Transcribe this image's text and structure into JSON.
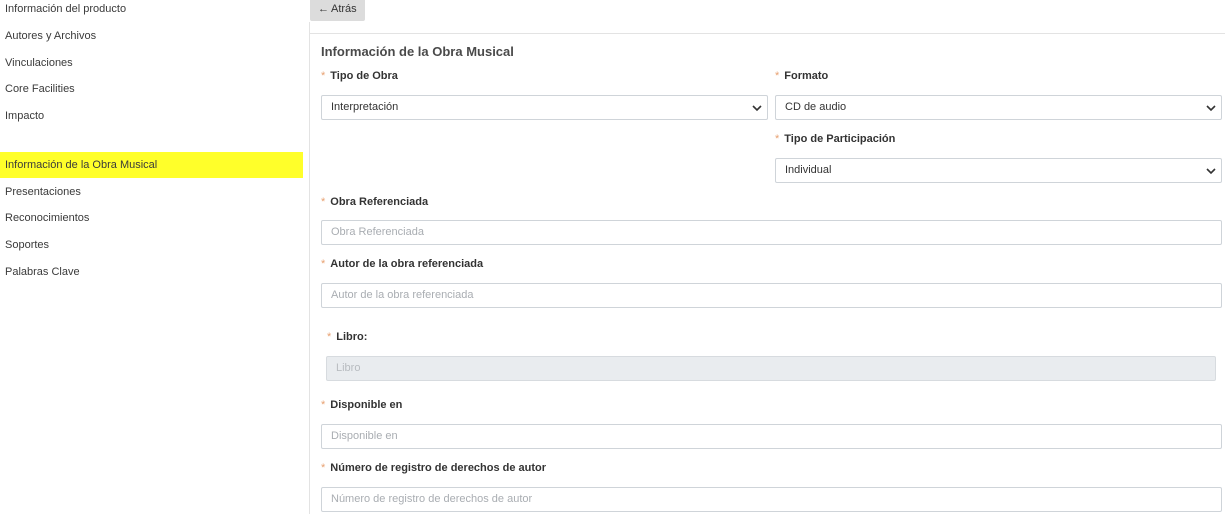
{
  "sidebar": {
    "group1": [
      "Información del producto",
      "Autores y Archivos",
      "Vinculaciones",
      "Core Facilities",
      "Impacto"
    ],
    "group2": [
      "Información de la Obra Musical",
      "Presentaciones",
      "Reconocimientos",
      "Soportes",
      "Palabras Clave"
    ]
  },
  "back_button": {
    "label": "Atrás"
  },
  "form": {
    "title": "Información de la Obra Musical",
    "tipo_obra": {
      "label": "Tipo de Obra",
      "value": "Interpretación"
    },
    "formato": {
      "label": "Formato",
      "value": "CD de audio"
    },
    "tipo_participacion": {
      "label": "Tipo de Participación",
      "value": "Individual"
    },
    "obra_referenciada": {
      "label": "Obra Referenciada",
      "placeholder": "Obra Referenciada"
    },
    "autor_obra": {
      "label": "Autor de la obra referenciada",
      "placeholder": "Autor de la obra referenciada"
    },
    "libro": {
      "label": "Libro:",
      "placeholder": "Libro"
    },
    "disponible_en": {
      "label": "Disponible en",
      "placeholder": "Disponible en"
    },
    "numero_registro": {
      "label": "Número de registro de derechos de autor",
      "placeholder": "Número de registro de derechos de autor"
    },
    "required_mark": "*"
  },
  "colors": {
    "highlight": "#ffff2a",
    "required": "#e8a070",
    "border": "#cfd4d9"
  }
}
